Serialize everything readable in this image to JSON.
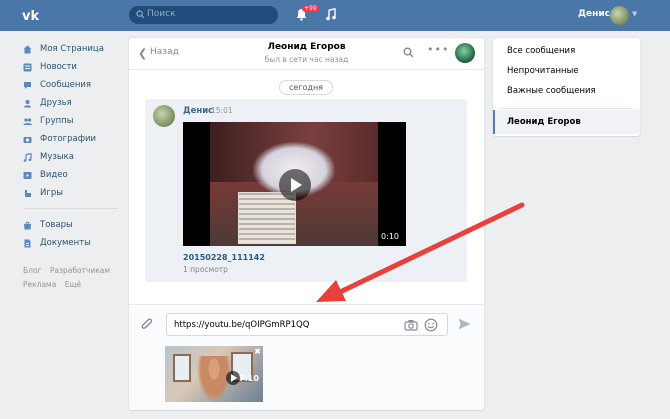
{
  "topbar": {
    "search_placeholder": "Поиск",
    "notifications_badge": "+99",
    "user_name": "Денис"
  },
  "sidebar": {
    "items": [
      {
        "label": "Моя Страница",
        "icon": "home-icon"
      },
      {
        "label": "Новости",
        "icon": "news-icon"
      },
      {
        "label": "Сообщения",
        "icon": "messages-icon"
      },
      {
        "label": "Друзья",
        "icon": "friends-icon"
      },
      {
        "label": "Группы",
        "icon": "groups-icon"
      },
      {
        "label": "Фотографии",
        "icon": "camera-icon"
      },
      {
        "label": "Музыка",
        "icon": "music-icon"
      },
      {
        "label": "Видео",
        "icon": "video-icon"
      },
      {
        "label": "Игры",
        "icon": "games-icon"
      }
    ],
    "items2": [
      {
        "label": "Товары",
        "icon": "goods-icon"
      },
      {
        "label": "Документы",
        "icon": "docs-icon"
      }
    ],
    "footer": [
      "Блог",
      "Разработчикам",
      "Реклама",
      "Ещё"
    ]
  },
  "chat": {
    "back_label": "Назад",
    "name": "Леонид Егоров",
    "status": "был в сети час назад",
    "day": "сегодня",
    "message": {
      "author": "Денис",
      "time": "15:01",
      "video_duration": "0:10",
      "video_title": "20150228_111142",
      "video_views": "1 просмотр"
    },
    "input_value": "https://youtu.be/qOIPGmRP1QQ",
    "attachment_duration": "7:10"
  },
  "right_panel": {
    "items": [
      "Все сообщения",
      "Непрочитанные",
      "Важные сообщения"
    ],
    "active": "Леонид Егоров"
  },
  "colors": {
    "topbar": "#4a76a8",
    "link": "#2a5885",
    "annotation_arrow": "#e8403a"
  }
}
